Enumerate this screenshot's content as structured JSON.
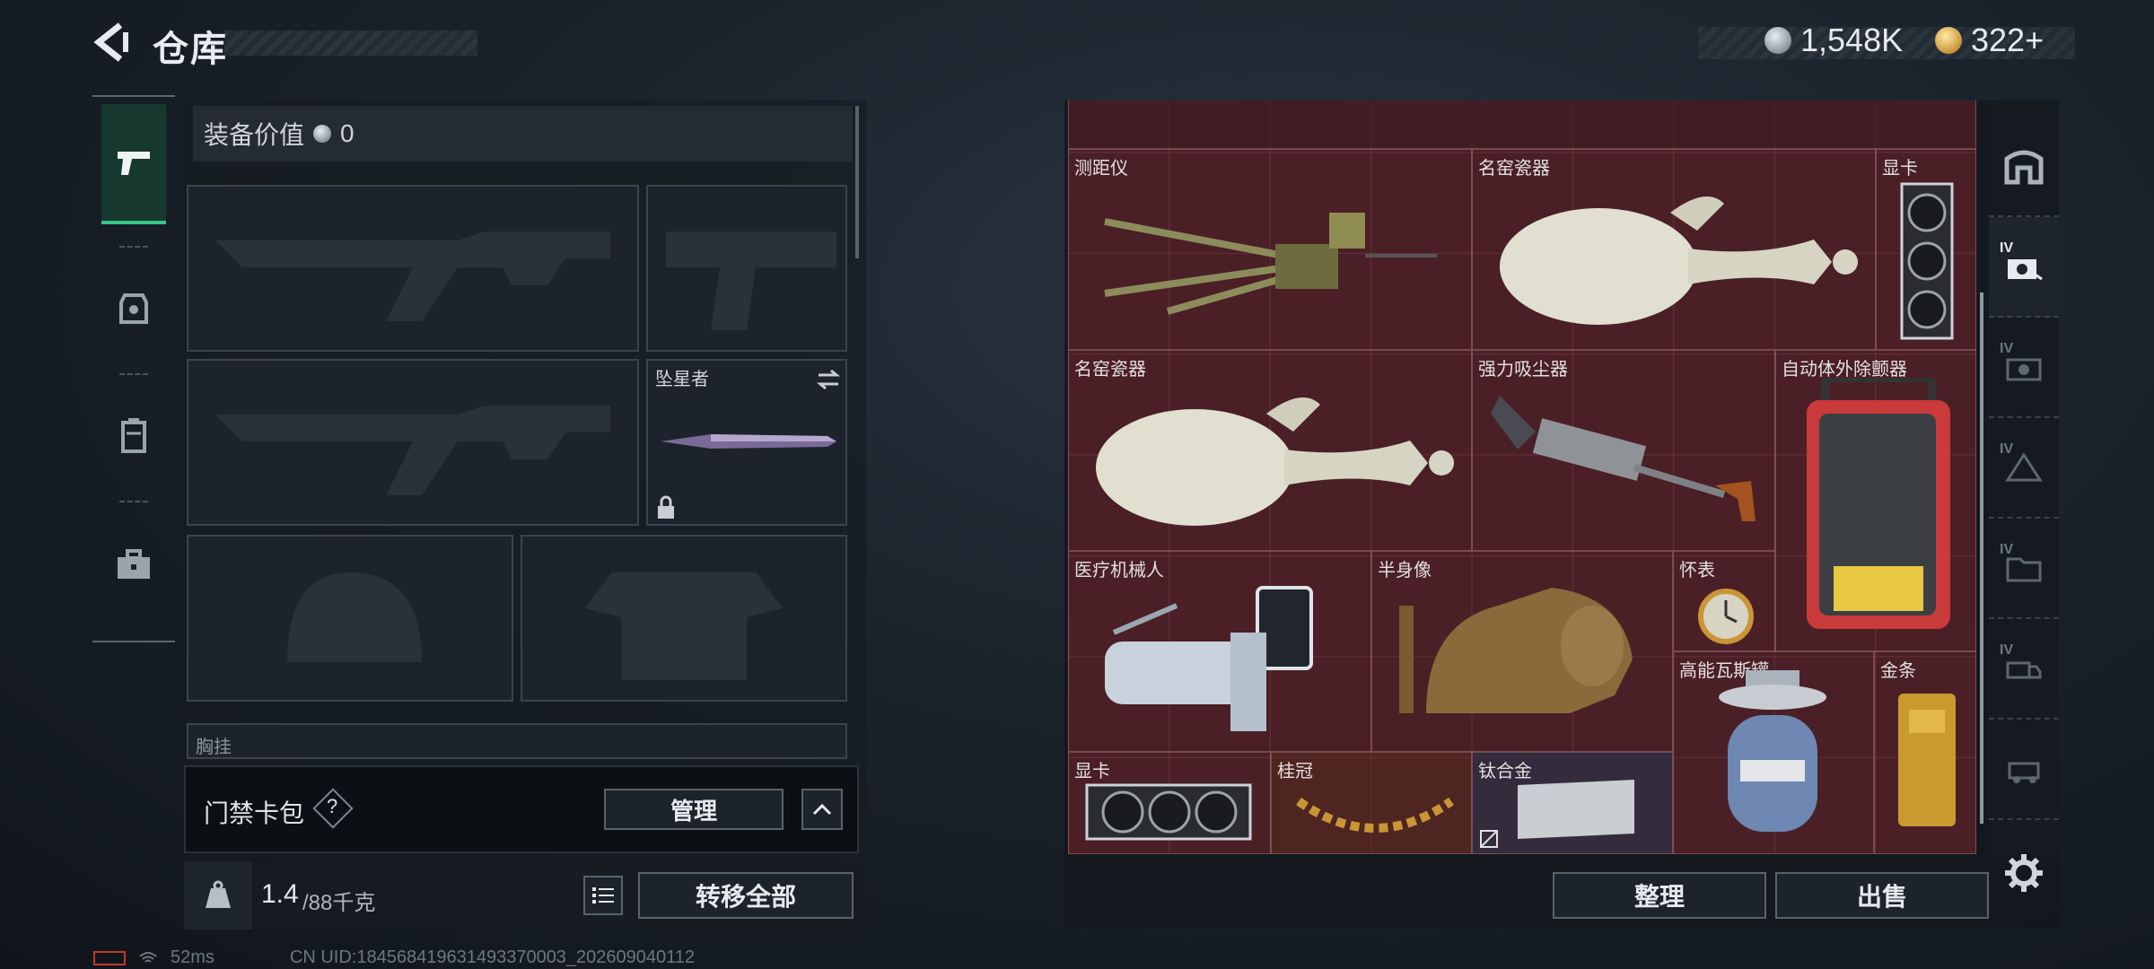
{
  "header": {
    "title": "仓库",
    "currency_silver": "1,548K",
    "currency_gold": "322+"
  },
  "left_nav": {
    "items": [
      "weapons-tab",
      "armor-tab",
      "backpack-tab",
      "toolbox-tab"
    ]
  },
  "equipment": {
    "value_label": "装备价值",
    "value": "0",
    "melee_name": "坠星者",
    "chest_label": "胸挂",
    "keycard_label": "门禁卡包",
    "help_mark": "?",
    "manage_label": "管理"
  },
  "capacity": {
    "current": "1.4",
    "max": "/88千克",
    "transfer_label": "转移全部"
  },
  "stash": {
    "items": [
      {
        "name": "测距仪"
      },
      {
        "name": "名窑瓷器"
      },
      {
        "name": "显卡"
      },
      {
        "name": "名窑瓷器"
      },
      {
        "name": "强力吸尘器"
      },
      {
        "name": "自动体外除颤器"
      },
      {
        "name": "医疗机械人"
      },
      {
        "name": "半身像"
      },
      {
        "name": "怀表"
      },
      {
        "name": "高能瓦斯罐"
      },
      {
        "name": "金条"
      },
      {
        "name": "显卡"
      },
      {
        "name": "桂冠"
      },
      {
        "name": "钛合金"
      }
    ],
    "sort_label": "整理",
    "sell_label": "出售"
  },
  "right_tabs": {
    "labels": [
      "IV",
      "IV",
      "IV",
      "IV",
      "IV"
    ]
  },
  "status": {
    "ping": "52ms",
    "uid": "CN UID:184568419631493370003_202609040112"
  },
  "colors": {
    "accent_green": "#37c58a",
    "stash_bg": "#4a1f26"
  }
}
